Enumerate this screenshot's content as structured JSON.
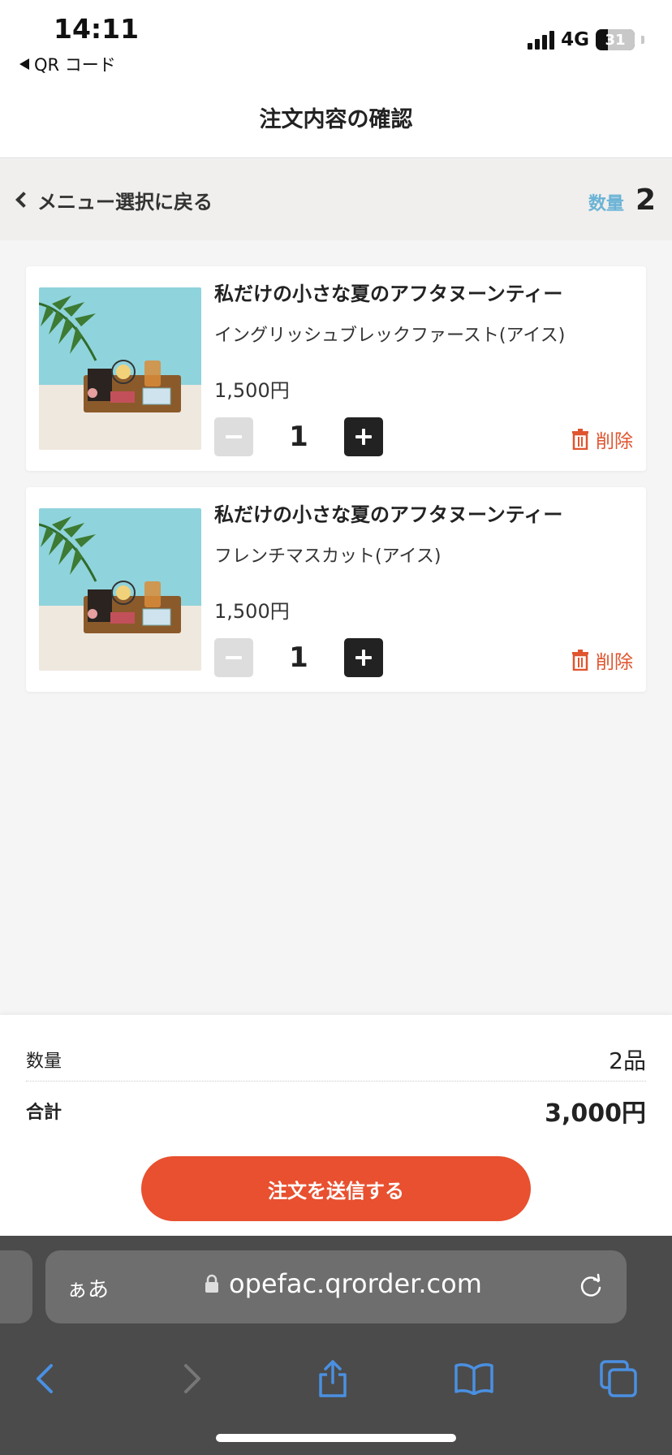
{
  "status_bar": {
    "time": "14:11",
    "back_label": "QR コード",
    "network": "4G",
    "battery": "31",
    "battery_level": 0.31
  },
  "header": {
    "title": "注文内容の確認"
  },
  "sub_header": {
    "back_label": "メニュー選択に戻る",
    "qty_label": "数量",
    "qty_value": "2"
  },
  "items": [
    {
      "name": "私だけの小さな夏のアフタヌーンティー",
      "option": "イングリッシュブレックファースト(アイス)",
      "price": "1,500円",
      "quantity": "1",
      "delete_label": "削除"
    },
    {
      "name": "私だけの小さな夏のアフタヌーンティー",
      "option": "フレンチマスカット(アイス)",
      "price": "1,500円",
      "quantity": "1",
      "delete_label": "削除"
    }
  ],
  "summary": {
    "qty_label": "数量",
    "qty_value": "2品",
    "total_label": "合計",
    "total_value": "3,000円",
    "submit_label": "注文を送信する"
  },
  "browser": {
    "aa_label": "ぁあ",
    "url": "opefac.qrorder.com"
  },
  "colors": {
    "accent": "#e8502f",
    "qty_label": "#6bb3d6",
    "delete": "#e0552f"
  }
}
